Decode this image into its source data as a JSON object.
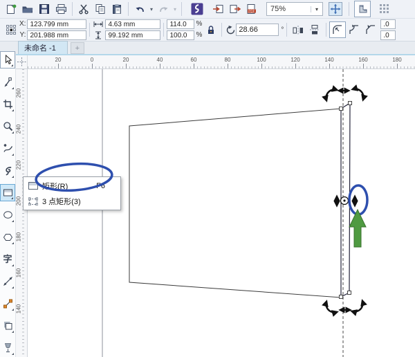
{
  "toolbar": {
    "zoom_value": "75%",
    "dropdown_glyph": "▾"
  },
  "propbar": {
    "x_label": "X:",
    "x_value": "123.799 mm",
    "y_label": "Y:",
    "y_value": "201.988 mm",
    "width_value": "4.63 mm",
    "height_value": "99.192 mm",
    "scale_h_value": "114.0",
    "scale_v_value": "100.0",
    "percent_sign": "%",
    "rotation_value": "28.66",
    "degree_sign": "°",
    "corner_top_value": ".0",
    "corner_bottom_value": ".0"
  },
  "tabbar": {
    "document_tab": "未命名 -1",
    "new_tab_glyph": "+"
  },
  "rulers": {
    "h": [
      "20",
      "0",
      "20",
      "40",
      "60",
      "80",
      "100",
      "120",
      "140",
      "160",
      "180"
    ],
    "v": [
      "260",
      "240",
      "220",
      "200",
      "180",
      "160",
      "140"
    ]
  },
  "toolbox": {
    "text_tool_glyph": "字"
  },
  "flyout_menu": {
    "items": [
      {
        "label": "矩形(R)",
        "shortcut": "F6"
      },
      {
        "label": "3 点矩形(3)",
        "shortcut": ""
      }
    ]
  },
  "colors": {
    "annotation_blue": "#2e4fae",
    "annotation_green": "#4f9a41",
    "tab_active_bg": "#d2e7f4",
    "tool_active_bg": "#cfe8f8",
    "toolbar_bg": "#eff2f7"
  }
}
